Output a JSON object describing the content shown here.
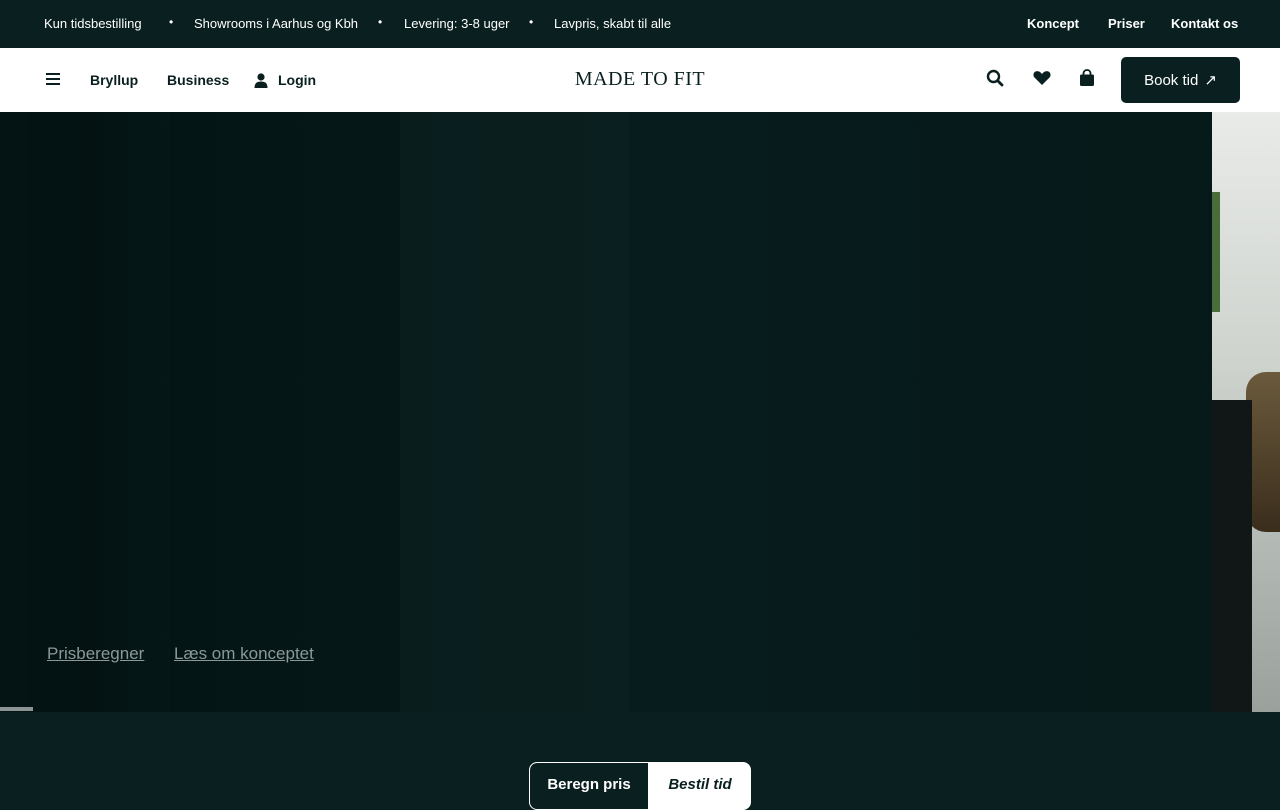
{
  "topbar": {
    "usps": [
      "Kun tidsbestilling",
      "Showrooms i Aarhus og Kbh",
      "Levering: 3-8 uger",
      "Lavpris, skabt til alle"
    ],
    "separator": "•",
    "links": [
      "Koncept",
      "Priser",
      "Kontakt os"
    ]
  },
  "header": {
    "nav": [
      "Bryllup",
      "Business"
    ],
    "login_label": "Login",
    "logo": "MADE TO FIT",
    "book_label": "Book tid",
    "book_arrow": "↗",
    "icons": [
      "menu-icon",
      "user-icon",
      "search-icon",
      "heart-icon",
      "bag-icon"
    ]
  },
  "hero": {
    "links": [
      "Prisberegner",
      "Læs om konceptet"
    ],
    "slider_progress": 0.03
  },
  "bottom": {
    "toggle": [
      "Beregn pris",
      "Bestil tid"
    ],
    "active_index": 0
  },
  "colors": {
    "brand_dark": "#0a1f1f",
    "white": "#ffffff"
  }
}
